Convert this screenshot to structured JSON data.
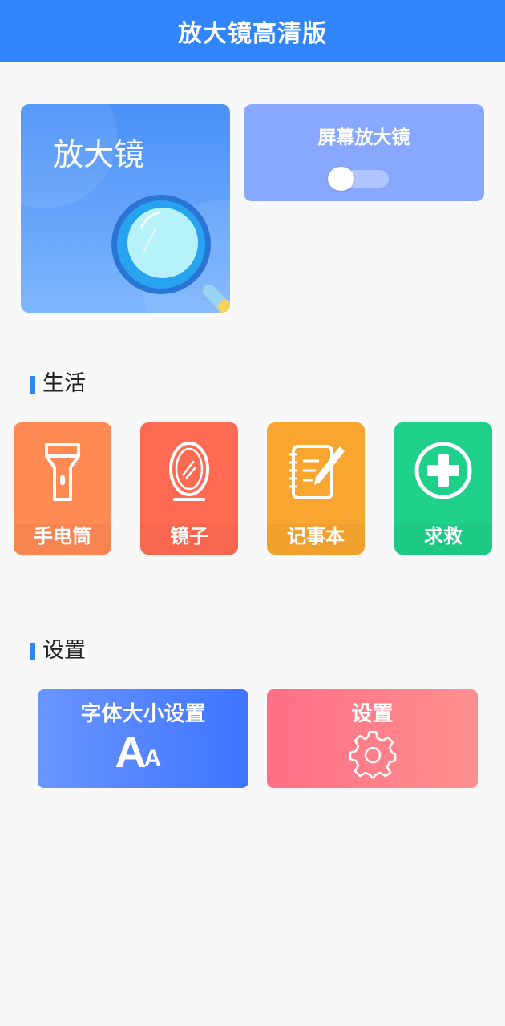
{
  "header": {
    "title": "放大镜高清版"
  },
  "magnifier_card": {
    "label": "放大镜",
    "icon": "magnifier-icon"
  },
  "screen_magnifier": {
    "label": "屏幕放大镜",
    "toggle_on": false
  },
  "life_section": {
    "title": "生活",
    "tiles": [
      {
        "label": "手电筒",
        "icon": "flashlight-icon",
        "color": "#ff8a54"
      },
      {
        "label": "镜子",
        "icon": "mirror-icon",
        "color": "#ff6a52"
      },
      {
        "label": "记事本",
        "icon": "notepad-icon",
        "color": "#f9a630"
      },
      {
        "label": "求救",
        "icon": "sos-plus-icon",
        "color": "#1fd08a"
      }
    ]
  },
  "settings_section": {
    "title": "设置",
    "cards": [
      {
        "label": "字体大小设置",
        "icon": "font-size-icon",
        "icon_text_big": "A",
        "icon_text_small": "A"
      },
      {
        "label": "设置",
        "icon": "gear-icon"
      }
    ]
  },
  "colors": {
    "primary": "#3085fb",
    "background": "#f8f8f8"
  }
}
